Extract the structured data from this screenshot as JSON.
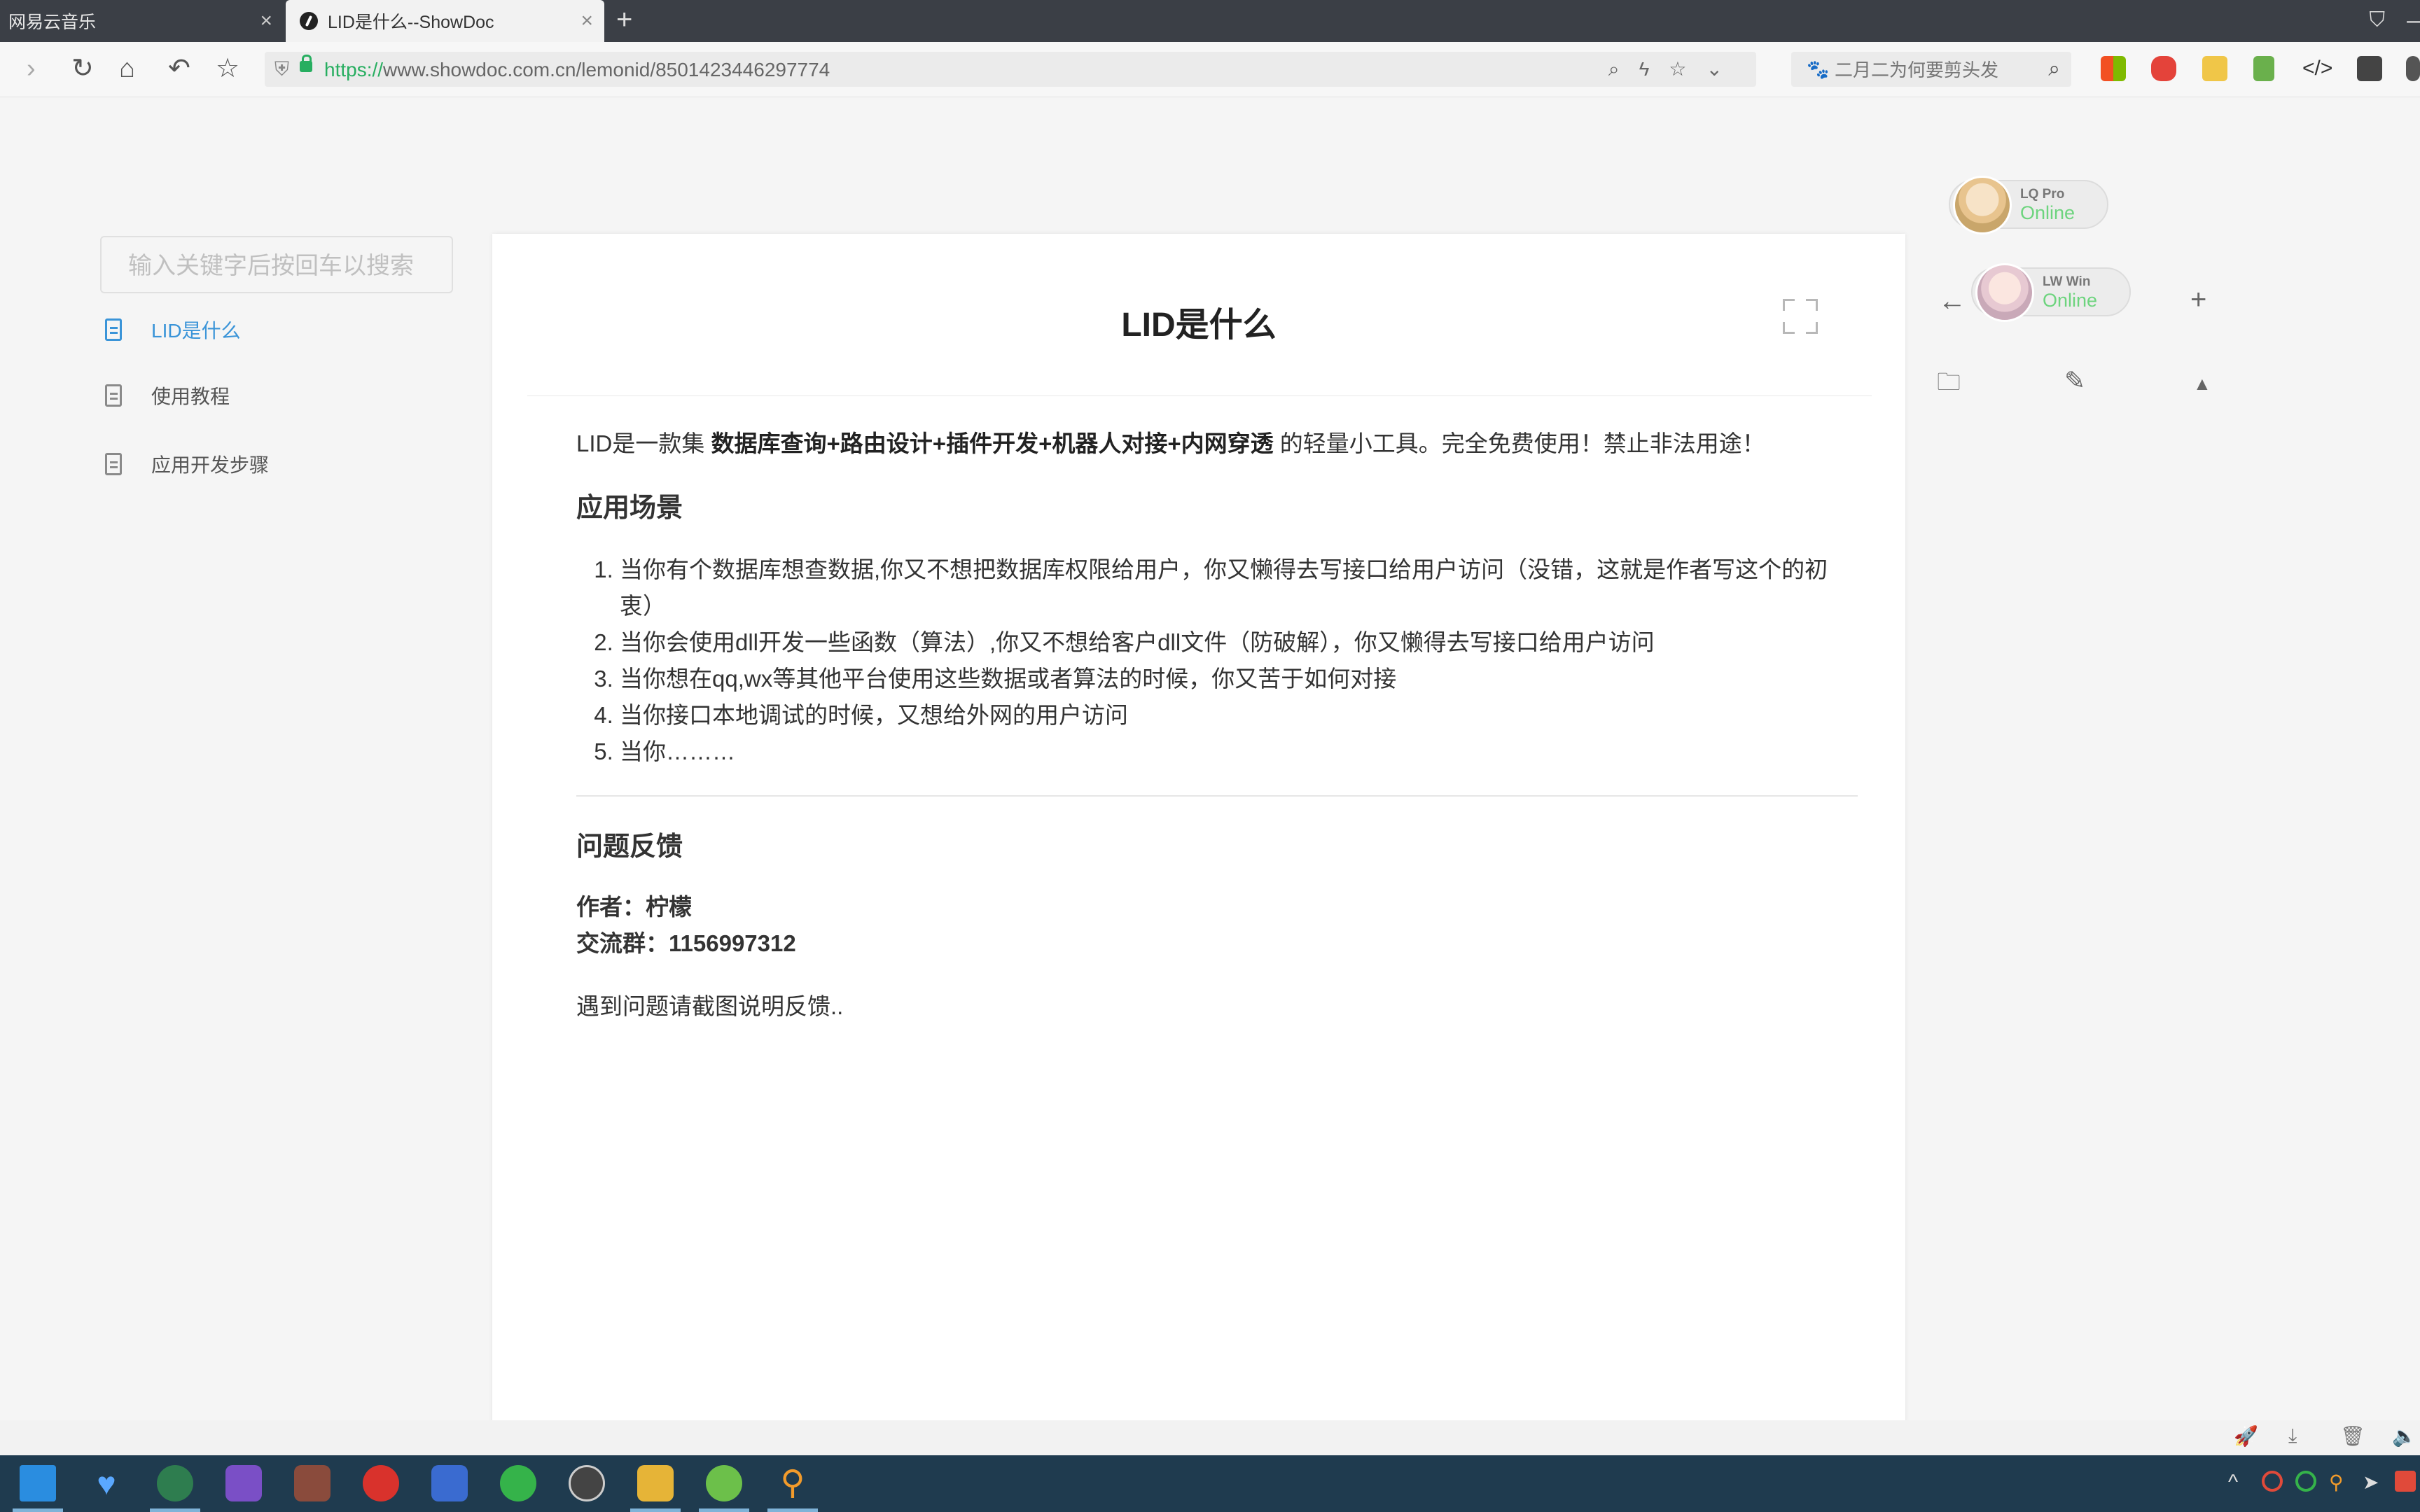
{
  "browser": {
    "tabs": [
      {
        "title": "网易云音乐",
        "active": false
      },
      {
        "title": "LID是什么--ShowDoc",
        "active": true
      }
    ],
    "url_scheme": "https://",
    "url_rest": "www.showdoc.com.cn/lemonid/8501423446297774",
    "search_placeholder": "二月二为何要剪头发",
    "icons": [
      "back-icon",
      "refresh-icon",
      "home-icon",
      "undo-icon",
      "star-icon",
      "shield-icon",
      "zoom-icon",
      "lightning-icon",
      "favorite-icon",
      "dropdown-icon"
    ]
  },
  "sidebar": {
    "search_placeholder": "输入关键字后按回车以搜索",
    "items": [
      {
        "label": "LID是什么",
        "active": true
      },
      {
        "label": "使用教程",
        "active": false
      },
      {
        "label": "应用开发步骤",
        "active": false
      }
    ]
  },
  "doc": {
    "title": "LID是什么",
    "intro_prefix": "LID是一款集 ",
    "intro_bold": "数据库查询+路由设计+插件开发+机器人对接+内网穿透",
    "intro_suffix": " 的轻量小工具。完全免费使用！禁止非法用途！",
    "section1_heading": "应用场景",
    "scenarios": [
      "当你有个数据库想查数据,你又不想把数据库权限给用户，你又懒得去写接口给用户访问（没错，这就是作者写这个的初衷）",
      "当你会使用dll开发一些函数（算法）,你又不想给客户dll文件（防破解），你又懒得去写接口给用户访问",
      "当你想在qq,wx等其他平台使用这些数据或者算法的时候，你又苦于如何对接",
      "当你接口本地调试的时候，又想给外网的用户访问",
      "当你………"
    ],
    "section2_heading": "问题反馈",
    "author": "作者：柠檬",
    "group": "交流群：1156997312",
    "feedback_note": "遇到问题请截图说明反馈.."
  },
  "right_panel": {
    "users": [
      {
        "name": "LQ Pro",
        "status": "Online"
      },
      {
        "name": "LW Win",
        "status": "Online"
      }
    ],
    "icons": [
      "arrow-left-icon",
      "plus-icon",
      "folder-icon",
      "edit-icon",
      "caret-up-icon"
    ]
  },
  "colors": {
    "accent": "#3a94d8",
    "online": "#6dd47e",
    "https_green": "#27ae60",
    "taskbar": "#1f3b4f"
  }
}
